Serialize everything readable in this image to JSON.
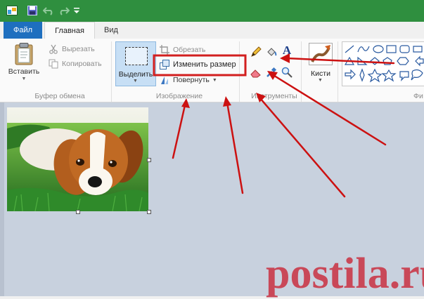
{
  "tabs": {
    "file": "Файл",
    "home": "Главная",
    "view": "Вид"
  },
  "clipboard": {
    "paste": "Вставить",
    "cut": "Вырезать",
    "copy": "Копировать",
    "group_label": "Буфер обмена"
  },
  "image_group": {
    "select": "Выделить",
    "crop": "Обрезать",
    "resize": "Изменить размер",
    "rotate": "Повернуть",
    "group_label": "Изображение"
  },
  "tools": {
    "group_label": "Инструменты"
  },
  "brushes": {
    "label": "Кисти"
  },
  "shapes": {
    "group_label_partial": "Фи"
  },
  "watermark": "postila.ru",
  "colors": {
    "titlebar": "#2f8f3f",
    "file_tab": "#1e6fbf",
    "highlight": "#d21f1f",
    "annotation_arrow": "#cc1111",
    "watermark": "#c94858"
  },
  "icons": [
    "save-icon",
    "undo-icon",
    "redo-icon",
    "customize-icon",
    "paste-icon",
    "cut-icon",
    "copy-icon",
    "select-icon",
    "crop-icon",
    "resize-icon",
    "rotate-icon",
    "pencil-icon",
    "fill-icon",
    "text-icon",
    "eraser-icon",
    "color-picker-icon",
    "magnifier-icon",
    "brush-icon"
  ]
}
